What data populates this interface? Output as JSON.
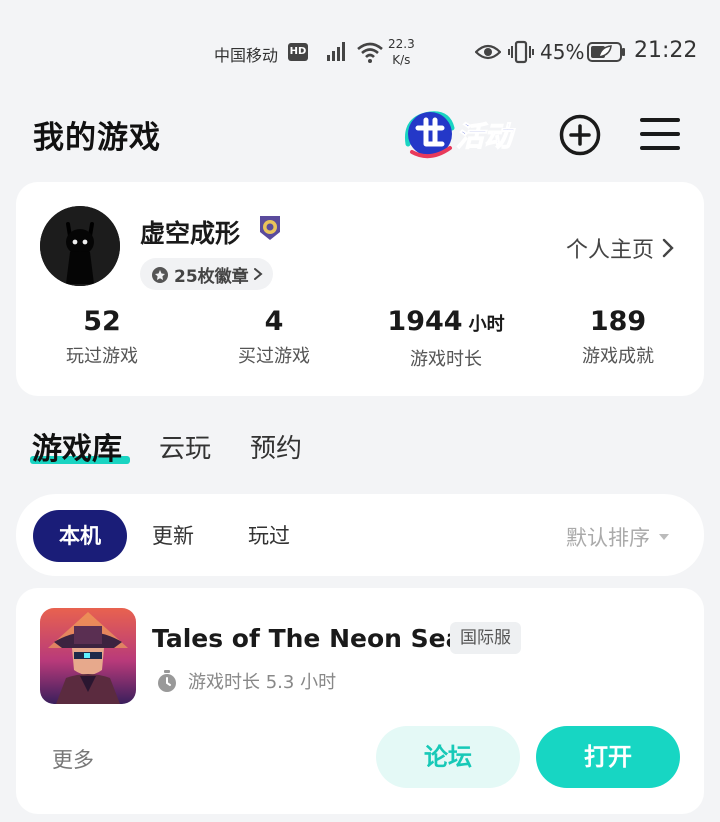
{
  "status_bar": {
    "carrier": "中国移动",
    "hd": "HD",
    "net_speed_value": "22.3",
    "net_speed_unit": "K/s",
    "battery": "45%",
    "time": "21:22"
  },
  "header": {
    "title": "我的游戏",
    "activity_label": "活动",
    "icons": [
      "add-circle-icon",
      "menu-icon"
    ]
  },
  "profile": {
    "username": "虚空成形",
    "badge_count": "25枚徽章",
    "homepage_link": "个人主页",
    "stats": [
      {
        "value": "52",
        "unit": "",
        "label": "玩过游戏"
      },
      {
        "value": "4",
        "unit": "",
        "label": "买过游戏"
      },
      {
        "value": "1944",
        "unit": "小时",
        "label": "游戏时长"
      },
      {
        "value": "189",
        "unit": "",
        "label": "游戏成就"
      }
    ]
  },
  "tabs": [
    {
      "label": "游戏库",
      "active": true
    },
    {
      "label": "云玩",
      "active": false
    },
    {
      "label": "预约",
      "active": false
    }
  ],
  "filters": {
    "chips": [
      {
        "label": "本机",
        "active": true
      },
      {
        "label": "更新",
        "active": false
      },
      {
        "label": "玩过",
        "active": false
      }
    ],
    "sort_label": "默认排序"
  },
  "game": {
    "title": "Tales of The Neon Sea",
    "region_tag": "国际服",
    "playtime": "游戏时长 5.3 小时",
    "more": "更多",
    "forum_button": "论坛",
    "open_button": "打开"
  },
  "colors": {
    "accent": "#17d6c3",
    "chip_active": "#1a1d78",
    "background": "#f3f4f6"
  }
}
